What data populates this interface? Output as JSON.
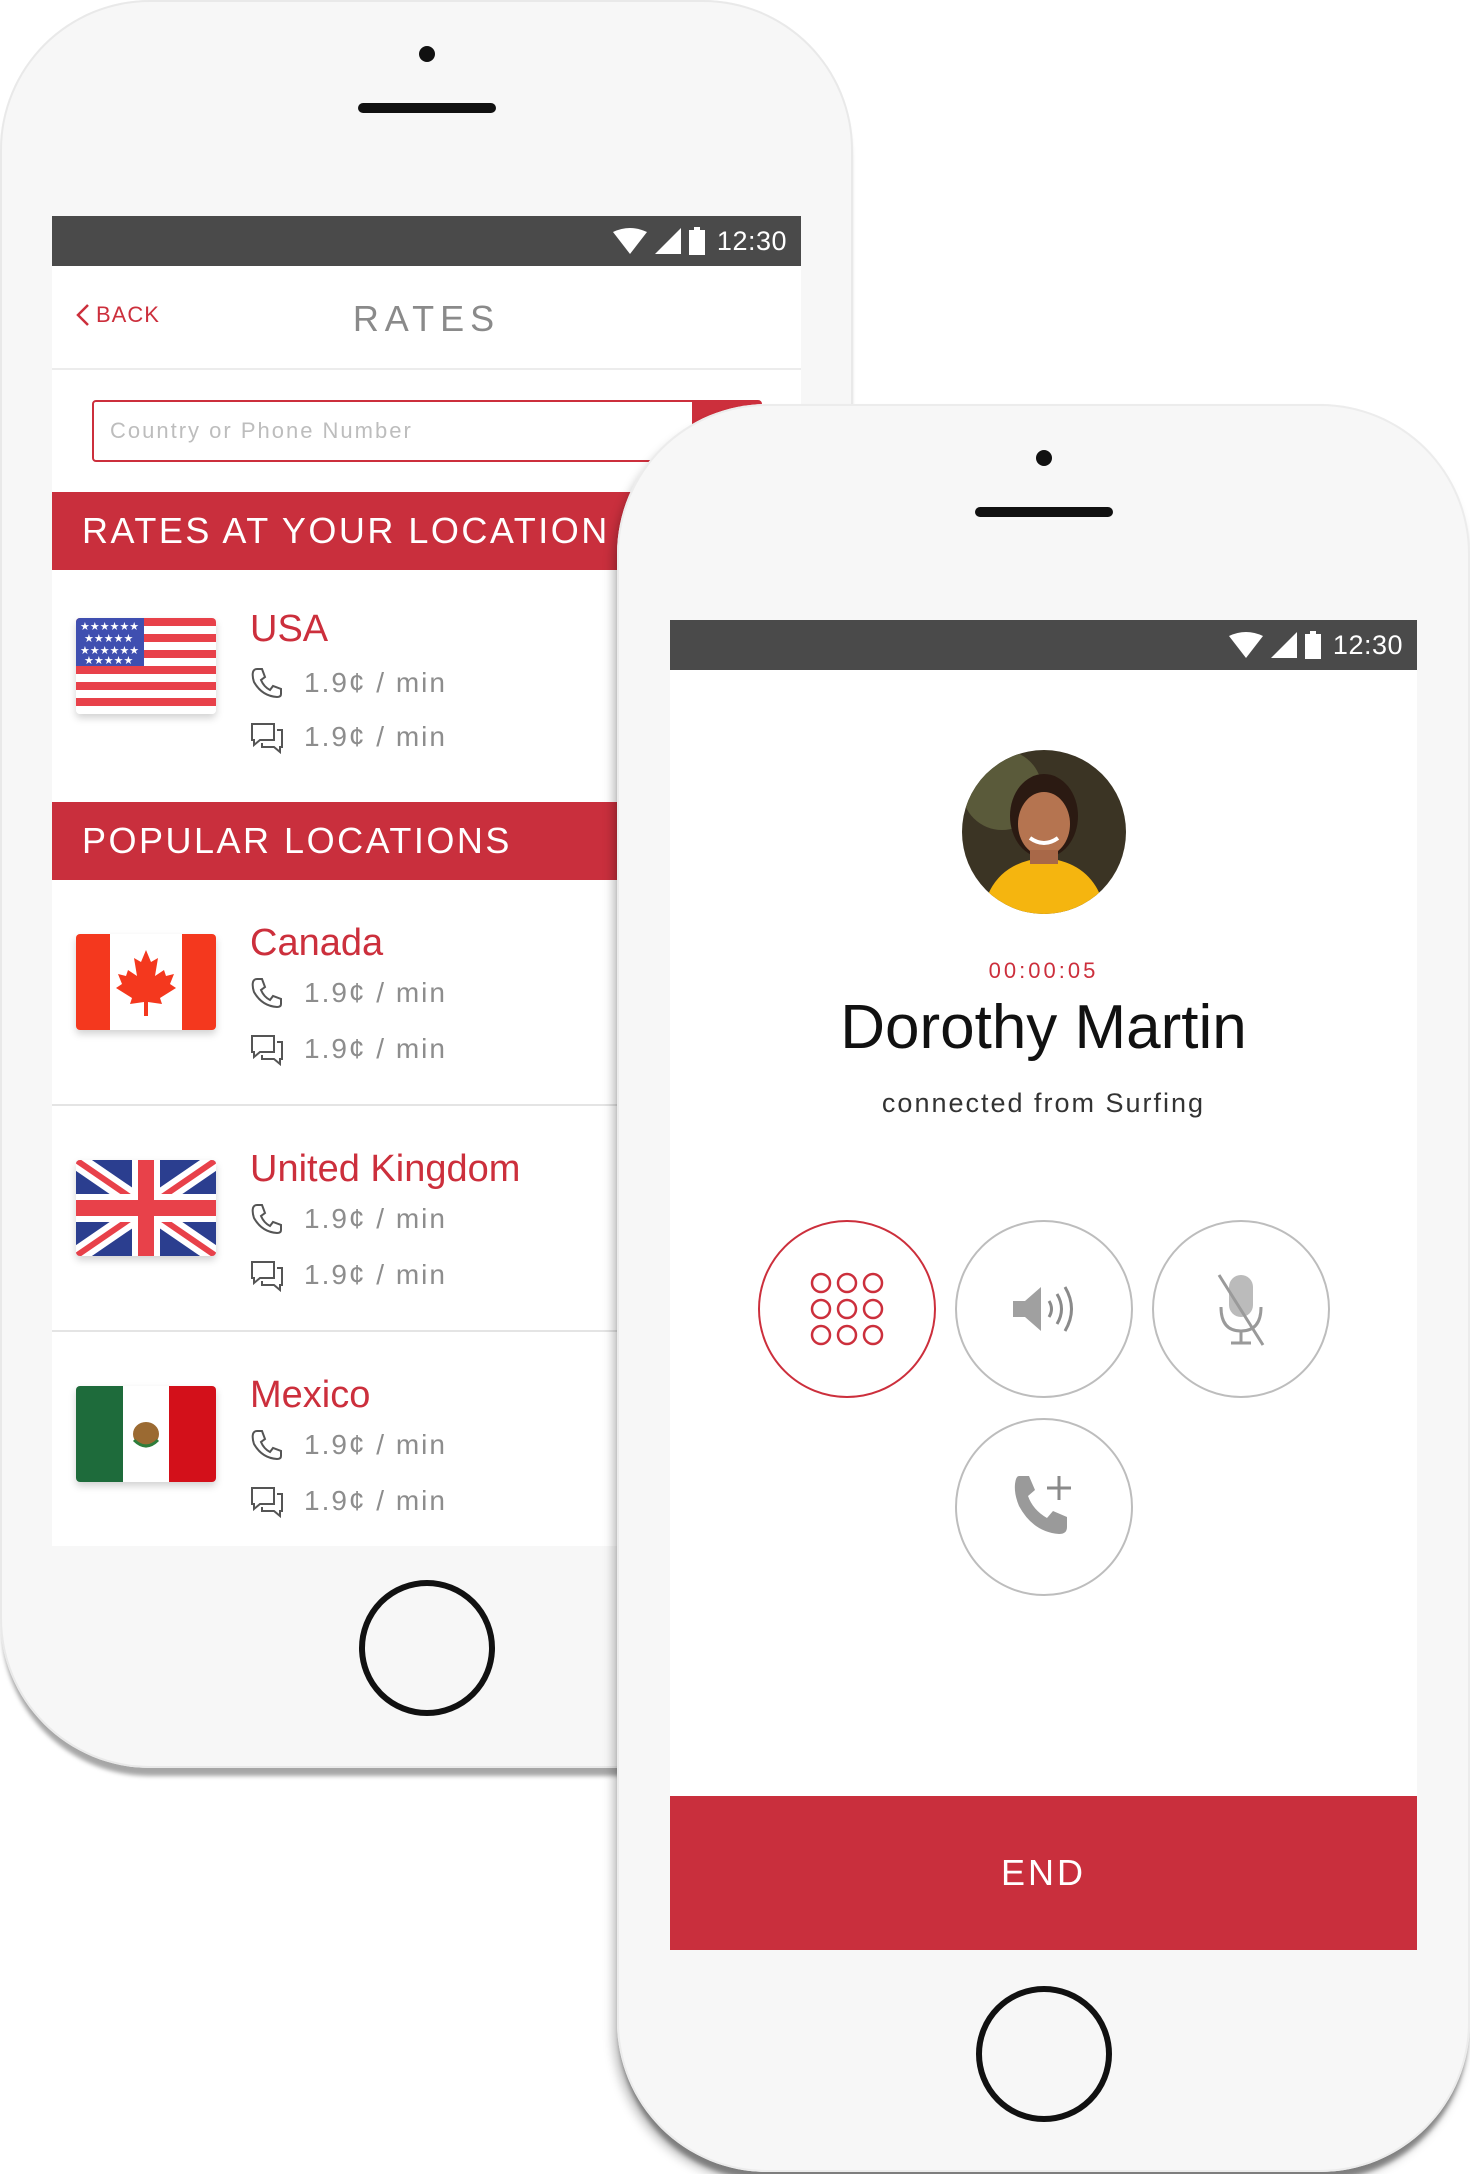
{
  "status_bar": {
    "time": "12:30",
    "icons": [
      "wifi-icon",
      "signal-icon",
      "battery-icon"
    ]
  },
  "rates_screen": {
    "back_label": "BACK",
    "title": "RATES",
    "search": {
      "placeholder": "Country or Phone Number",
      "value": ""
    },
    "section_location": "RATES AT YOUR LOCATION",
    "section_popular": "POPULAR LOCATIONS",
    "your_location": {
      "name": "USA",
      "call_rate": "1.9¢ / min",
      "sms_rate": "1.9¢ / min"
    },
    "popular": [
      {
        "name": "Canada",
        "call_rate": "1.9¢ / min",
        "sms_rate": "1.9¢ / min"
      },
      {
        "name": "United Kingdom",
        "call_rate": "1.9¢ / min",
        "sms_rate": "1.9¢ / min"
      },
      {
        "name": "Mexico",
        "call_rate": "1.9¢ / min",
        "sms_rate": "1.9¢ / min"
      }
    ]
  },
  "call_screen": {
    "timer": "00:00:05",
    "caller_name": "Dorothy Martin",
    "connection": "connected from Surfing",
    "controls": [
      "keypad-icon",
      "speaker-icon",
      "mute-icon",
      "add-call-icon"
    ],
    "end_label": "END"
  },
  "colors": {
    "accent": "#c92f3d",
    "status_bar": "#4a4a4a",
    "muted_text": "#8d8d8d"
  }
}
